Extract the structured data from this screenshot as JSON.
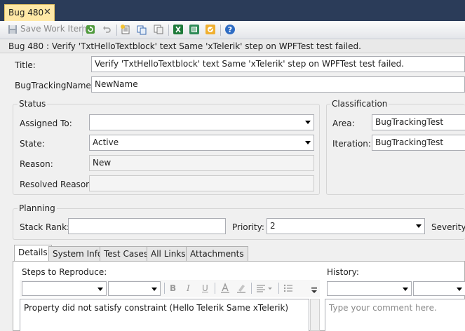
{
  "tab": {
    "label": "Bug 480",
    "close": "✕"
  },
  "toolbar": {
    "save_label": "Save Work Item"
  },
  "header": {
    "text": "Bug 480 : Verify 'TxtHelloTextblock' text Same 'xTelerik' step on WPFTest test failed."
  },
  "fields": {
    "title_label": "Title:",
    "title_value": "Verify 'TxtHelloTextblock' text Same 'xTelerik' step on WPFTest test failed.",
    "bugtracking_label": "BugTrackingName:",
    "bugtracking_value": "NewName"
  },
  "status": {
    "title": "Status",
    "assigned_label": "Assigned To:",
    "assigned_value": "",
    "state_label": "State:",
    "state_value": "Active",
    "reason_label": "Reason:",
    "reason_value": "New",
    "resolved_label": "Resolved Reason:",
    "resolved_value": ""
  },
  "classification": {
    "title": "Classification",
    "area_label": "Area:",
    "area_value": "BugTrackingTest",
    "iteration_label": "Iteration:",
    "iteration_value": "BugTrackingTest"
  },
  "planning": {
    "title": "Planning",
    "stackrank_label": "Stack Rank:",
    "stackrank_value": "",
    "priority_label": "Priority:",
    "priority_value": "2",
    "severity_label": "Severity:"
  },
  "tabs": [
    {
      "label": "Details"
    },
    {
      "label": "System Info"
    },
    {
      "label": "Test Cases"
    },
    {
      "label": "All Links"
    },
    {
      "label": "Attachments"
    }
  ],
  "details": {
    "steps_label": "Steps to Reproduce:",
    "steps_text": "Property did not satisfy constraint (Hello Telerik Same xTelerik)",
    "history_label": "History:",
    "history_placeholder": "Type your comment here."
  },
  "format_buttons": {
    "bold": "B",
    "italic": "I",
    "underline": "U"
  },
  "colors": {
    "tabstrip": "#2b3c59",
    "active_tab": "#ffe8a6"
  }
}
